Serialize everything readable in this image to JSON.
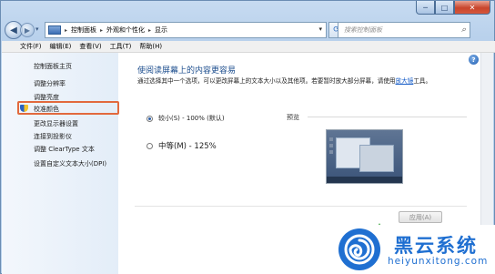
{
  "window": {
    "controls": {
      "minimize": "─",
      "maximize": "□",
      "close": "✕"
    }
  },
  "nav": {
    "back_glyph": "◀",
    "forward_glyph": "▶",
    "history_glyph": "▾",
    "breadcrumb": [
      "控制面板",
      "外观和个性化",
      "显示"
    ],
    "breadcrumb_sep": "▸",
    "dropdown_glyph": "▾",
    "refresh_glyph": "⟳",
    "search_placeholder": "搜索控制面板",
    "search_glyph": "⌕"
  },
  "menubar": {
    "items": [
      "文件(F)",
      "编辑(E)",
      "查看(V)",
      "工具(T)",
      "帮助(H)"
    ]
  },
  "sidebar": {
    "items": [
      "控制面板主页",
      "调整分辨率",
      "调整亮度",
      "校准颜色",
      "更改显示器设置",
      "连接到投影仪",
      "调整 ClearType 文本",
      "设置自定义文本大小(DPI)"
    ],
    "highlighted_index": 3,
    "highlight_color": "#e2693d"
  },
  "main": {
    "title": "使阅读屏幕上的内容更容易",
    "description": "通过选择其中一个选项，可以更改屏幕上的文本大小以及其他项。若要暂时放大部分屏幕，请使用",
    "description_link": "放大镜",
    "description_tail": "工具。",
    "options": [
      {
        "label": "较小(S) - 100% (默认)",
        "checked": true
      },
      {
        "label": "中等(M) - 125%",
        "checked": false
      }
    ],
    "preview_label": "预览",
    "apply_label": "应用(A)",
    "help_glyph": "?"
  },
  "watermark": {
    "name": "黑云系统",
    "url": "heiyunxitong.com",
    "color": "#1f6fd1"
  }
}
